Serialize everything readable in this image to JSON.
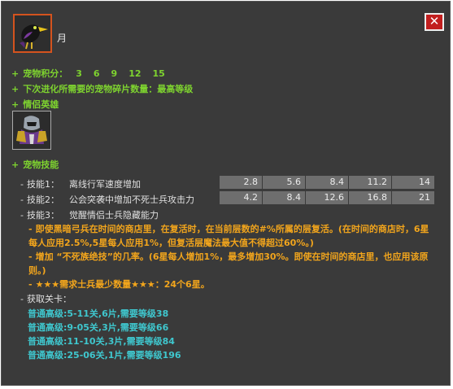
{
  "pet": {
    "name": "月",
    "portrait_icon": "crow-icon"
  },
  "close_icon": "close-icon",
  "score": {
    "label": "宠物积分：",
    "values": [
      "3",
      "6",
      "9",
      "12",
      "15"
    ]
  },
  "next_evolution": "下次进化所需要的宠物碎片数量：最高等级",
  "companion": {
    "label": "情侣英雄",
    "hero_icon": "armored-hero-icon"
  },
  "skills_label": "宠物技能",
  "skills": [
    {
      "label": "技能1：",
      "desc": "离线行军速度增加",
      "values": [
        "2.8",
        "5.6",
        "8.4",
        "11.2",
        "14"
      ]
    },
    {
      "label": "技能2：",
      "desc": "公会突袭中增加不死士兵攻击力",
      "values": [
        "4.2",
        "8.4",
        "12.6",
        "16.8",
        "21"
      ]
    }
  ],
  "skill3": {
    "label": "技能3：",
    "desc": "觉醒情侣士兵隐藏能力",
    "bullets": [
      "即使黑暗弓兵在时间的商店里，在复活时，在当前层数的#%所属的层复活。(在时间的商店时，6星每人应用2.5%,5星每人应用1%，但复活层魔法最大值不得超过60%。)",
      "增加 “不死族绝技”的几率。(6星每人增加1%，最多增加30%。即使在时间的商店里，也应用该原则。)",
      "★★★需求士兵最少数量★★★：24个6星。"
    ]
  },
  "acquire": {
    "label": "获取关卡：",
    "stages": [
      "普通高级:5-11关,6片,需要等级38",
      "普通高级:9-05关,3片,需要等级66",
      "普通高级:11-10关,3片,需要等级84",
      "普通高级:25-06关,1片,需要等级196"
    ]
  },
  "symbols": {
    "plus": "+",
    "dash": "-"
  },
  "colors": {
    "green": "#7ed32f",
    "orange": "#f2a51c",
    "cyan": "#3fc7ce",
    "frame": "#3a3a3a",
    "close": "#c21f1f"
  }
}
